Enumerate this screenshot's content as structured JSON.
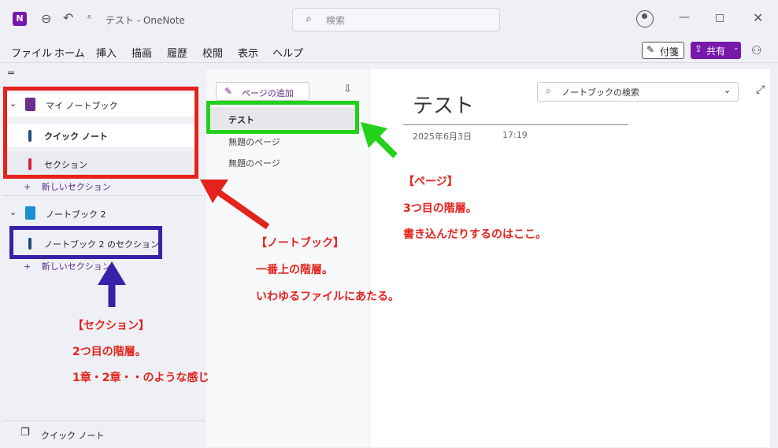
{
  "titlebar": {
    "app_icon_letter": "N",
    "window_title": "テスト - OneNote",
    "search_placeholder": "検索"
  },
  "menubar": {
    "items": [
      "ファイル",
      "ホーム",
      "挿入",
      "描画",
      "履歴",
      "校閲",
      "表示",
      "ヘルプ"
    ],
    "sticky_notes_label": "付箋",
    "share_label": "共有"
  },
  "sidebar": {
    "notebooks": [
      {
        "name": "マイ ノートブック",
        "color": "#6b2f8c",
        "sections": [
          {
            "name": "クイック ノート",
            "color": "#1f4e79",
            "bold": true
          },
          {
            "name": "セクション",
            "color": "#d6223a",
            "bold": false
          }
        ],
        "new_section_label": "新しいセクション"
      },
      {
        "name": "ノートブック 2",
        "color": "#1a8fd1",
        "sections": [
          {
            "name": "ノートブック 2 のセクション",
            "color": "#1f4e79",
            "bold": false
          }
        ],
        "new_section_label": "新しいセクション"
      }
    ],
    "bottom_label": "クイック ノート"
  },
  "pagelist": {
    "add_page_label": "ページの追加",
    "pages": [
      "テスト",
      "無題のページ",
      "無題のページ"
    ]
  },
  "canvas": {
    "notebook_search_placeholder": "ノートブックの検索",
    "page_title": "テスト",
    "date": "2025年6月3日",
    "time": "17:19"
  },
  "annotations": {
    "notebook": [
      "【ノートブック】",
      "一番上の階層。",
      "いわゆるファイルにあたる。"
    ],
    "section": [
      "【セクション】",
      "2つ目の階層。",
      "1章・2章・・のような感じ"
    ],
    "page": [
      "【ページ】",
      "3つ目の階層。",
      "書き込んだりするのはここ。"
    ],
    "colors": {
      "red": "#e3231c",
      "green": "#22d11a",
      "purple": "#3a1fa8"
    }
  }
}
